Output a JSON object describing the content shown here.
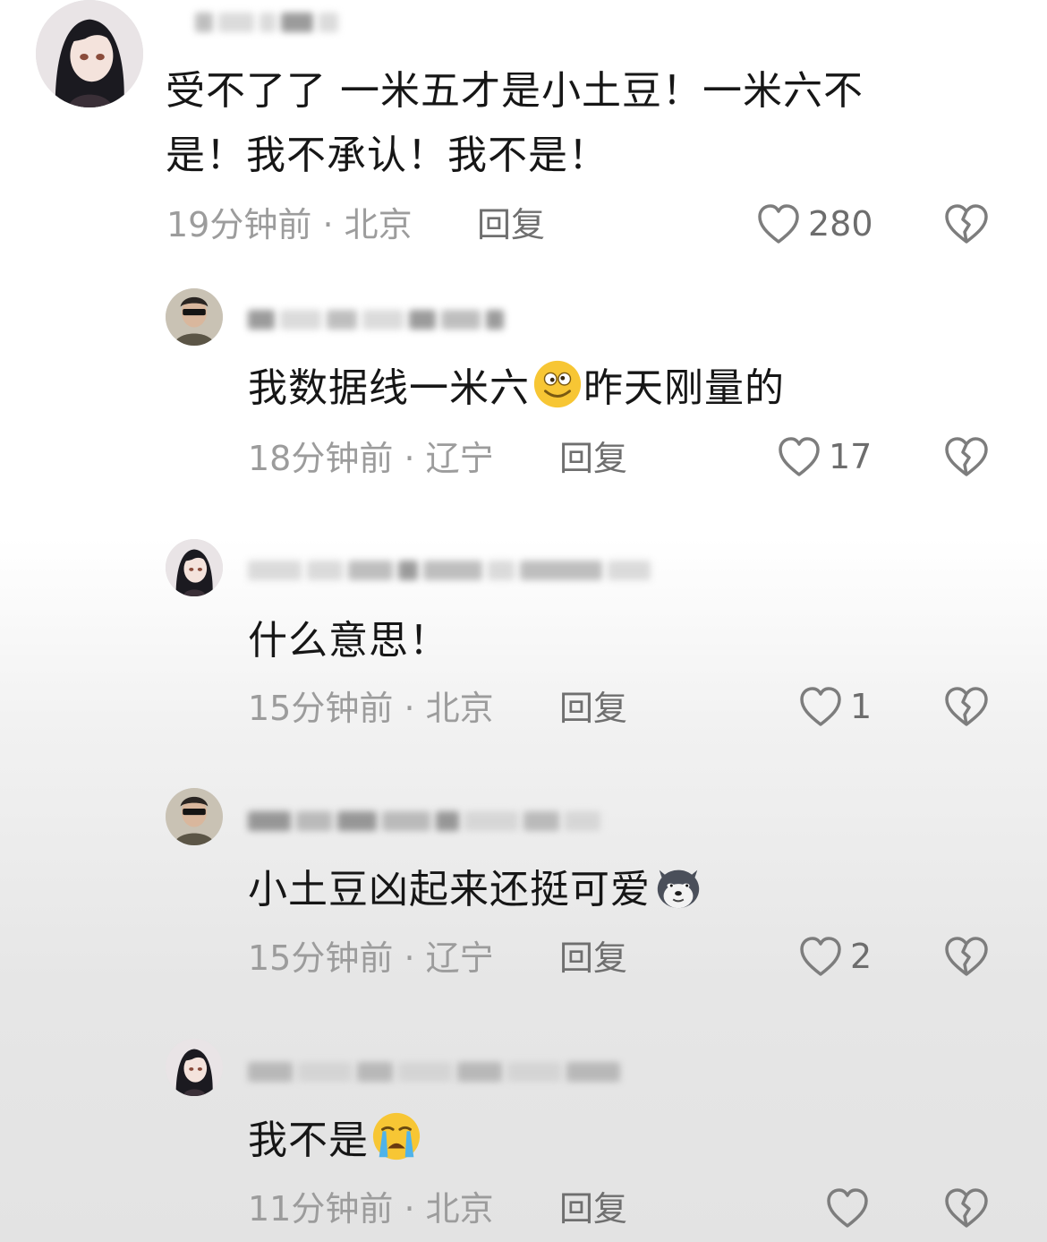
{
  "comments": [
    {
      "text": "受不了了 一米五才是小土豆！一米六不是！我不承认！我不是！",
      "line1": "受不了了 一米五才是小土豆！一米六不",
      "line2": "是！我不承认！我不是！",
      "time": "19分钟前",
      "location": "北京",
      "reply_label": "回复",
      "likes": "280"
    },
    {
      "text": "我数据线一米六",
      "text_after": "昨天刚量的",
      "emoji": "dizzy-smile-emoji",
      "time": "18分钟前",
      "location": "辽宁",
      "reply_label": "回复",
      "likes": "17"
    },
    {
      "text": "什么意思！",
      "time": "15分钟前",
      "location": "北京",
      "reply_label": "回复",
      "likes": "1"
    },
    {
      "text": "小土豆凶起来还挺可爱",
      "emoji": "husky-emoji",
      "time": "15分钟前",
      "location": "辽宁",
      "reply_label": "回复",
      "likes": "2"
    },
    {
      "text": "我不是",
      "emoji": "crying-emoji",
      "time": "11分钟前",
      "location": "北京",
      "reply_label": "回复",
      "likes": ""
    }
  ],
  "separator": " · ",
  "icons": {
    "like": "heart-outline-icon",
    "dislike": "broken-heart-icon"
  }
}
